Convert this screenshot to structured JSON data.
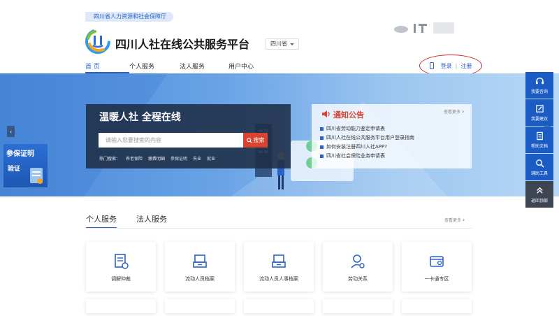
{
  "header": {
    "dept_tag": "四川省人力资源和社会保障厅",
    "site_title": "四川人社在线公共服务平台",
    "province_select": "四川省",
    "nav": [
      "首 页",
      "个人服务",
      "法人服务",
      "用户中心"
    ],
    "login": "登录",
    "separator": "|",
    "register": "注册"
  },
  "banner": {
    "slogan": "温暖人社 全程在线",
    "search_placeholder": "请输入您要搜索的内容",
    "search_button": "搜索",
    "hot_label": "热门搜索：",
    "hot_terms": [
      "养老保险",
      "缴费明细",
      "参保证明",
      "失业",
      "就业"
    ],
    "promo_line1": "参保证明",
    "promo_line2": "验证",
    "arrow_prev": "‹",
    "arrow_next": "›"
  },
  "notice": {
    "title": "通知公告",
    "more": "查看更多",
    "items": [
      "四川省劳动能力鉴定申请表",
      "四川人社在线公共服务平台用户登录指南",
      "如何安装注册四川人社APP?",
      "四川省社会保险业务申请表"
    ]
  },
  "toolbar": [
    "我要咨询",
    "我要建议",
    "帮助文档",
    "辅助工具",
    "返回顶部"
  ],
  "services": {
    "tabs": [
      "个人服务",
      "法人服务"
    ],
    "more": "查看更多",
    "cards": [
      "调解仲裁",
      "流动人员档案",
      "流动人员人事档案",
      "劳动关系",
      "一卡通专区"
    ]
  },
  "colors": {
    "primary": "#2b62c8",
    "search_button": "#d9432f",
    "login_circle": "#d42b2b",
    "toolbar": "#1b5cc4",
    "toolbar_dark": "#3e4552"
  },
  "icons": [
    "phone-icon",
    "speaker-icon",
    "headset-icon",
    "edit-icon",
    "document-icon",
    "search-icon",
    "double-chevron-up-icon",
    "search-icon-small"
  ]
}
